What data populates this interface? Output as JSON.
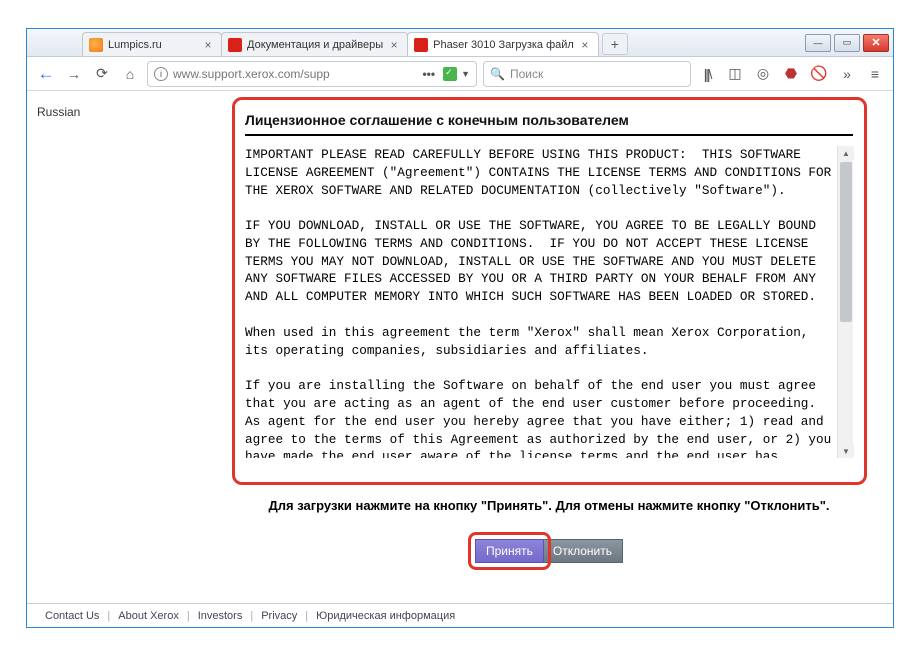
{
  "tabs": [
    {
      "title": "Lumpics.ru",
      "favicon": "orange"
    },
    {
      "title": "Документация и драйверы",
      "favicon": "red"
    },
    {
      "title": "Phaser 3010 Загрузка файл",
      "favicon": "red",
      "active": true
    }
  ],
  "url": "www.support.xerox.com/supp",
  "search_placeholder": "Поиск",
  "sidebar": {
    "language": "Russian"
  },
  "eula": {
    "title": "Лицензионное соглашение с конечным пользователем",
    "body": "IMPORTANT PLEASE READ CAREFULLY BEFORE USING THIS PRODUCT:  THIS SOFTWARE LICENSE AGREEMENT (\"Agreement\") CONTAINS THE LICENSE TERMS AND CONDITIONS FOR THE XEROX SOFTWARE AND RELATED DOCUMENTATION (collectively \"Software\").\n\nIF YOU DOWNLOAD, INSTALL OR USE THE SOFTWARE, YOU AGREE TO BE LEGALLY BOUND BY THE FOLLOWING TERMS AND CONDITIONS.  IF YOU DO NOT ACCEPT THESE LICENSE TERMS YOU MAY NOT DOWNLOAD, INSTALL OR USE THE SOFTWARE AND YOU MUST DELETE ANY SOFTWARE FILES ACCESSED BY YOU OR A THIRD PARTY ON YOUR BEHALF FROM ANY AND ALL COMPUTER MEMORY INTO WHICH SUCH SOFTWARE HAS BEEN LOADED OR STORED.\n\nWhen used in this agreement the term \"Xerox\" shall mean Xerox Corporation, its operating companies, subsidiaries and affiliates.\n\nIf you are installing the Software on behalf of the end user you must agree that you are acting as an agent of the end user customer before proceeding.  As agent for the end user you hereby agree that you have either; 1) read and agree to the terms of this Agreement as authorized by the end user, or 2) you have made the end user aware of the license terms and the end user has explicitly accepted them."
  },
  "instruction": "Для загрузки нажмите на кнопку \"Принять\". Для отмены нажмите кнопку \"Отклонить\".",
  "buttons": {
    "accept": "Принять",
    "decline": "Отклонить"
  },
  "footer": {
    "links": [
      "Contact Us",
      "About Xerox",
      "Investors",
      "Privacy",
      "Юридическая информация"
    ]
  }
}
